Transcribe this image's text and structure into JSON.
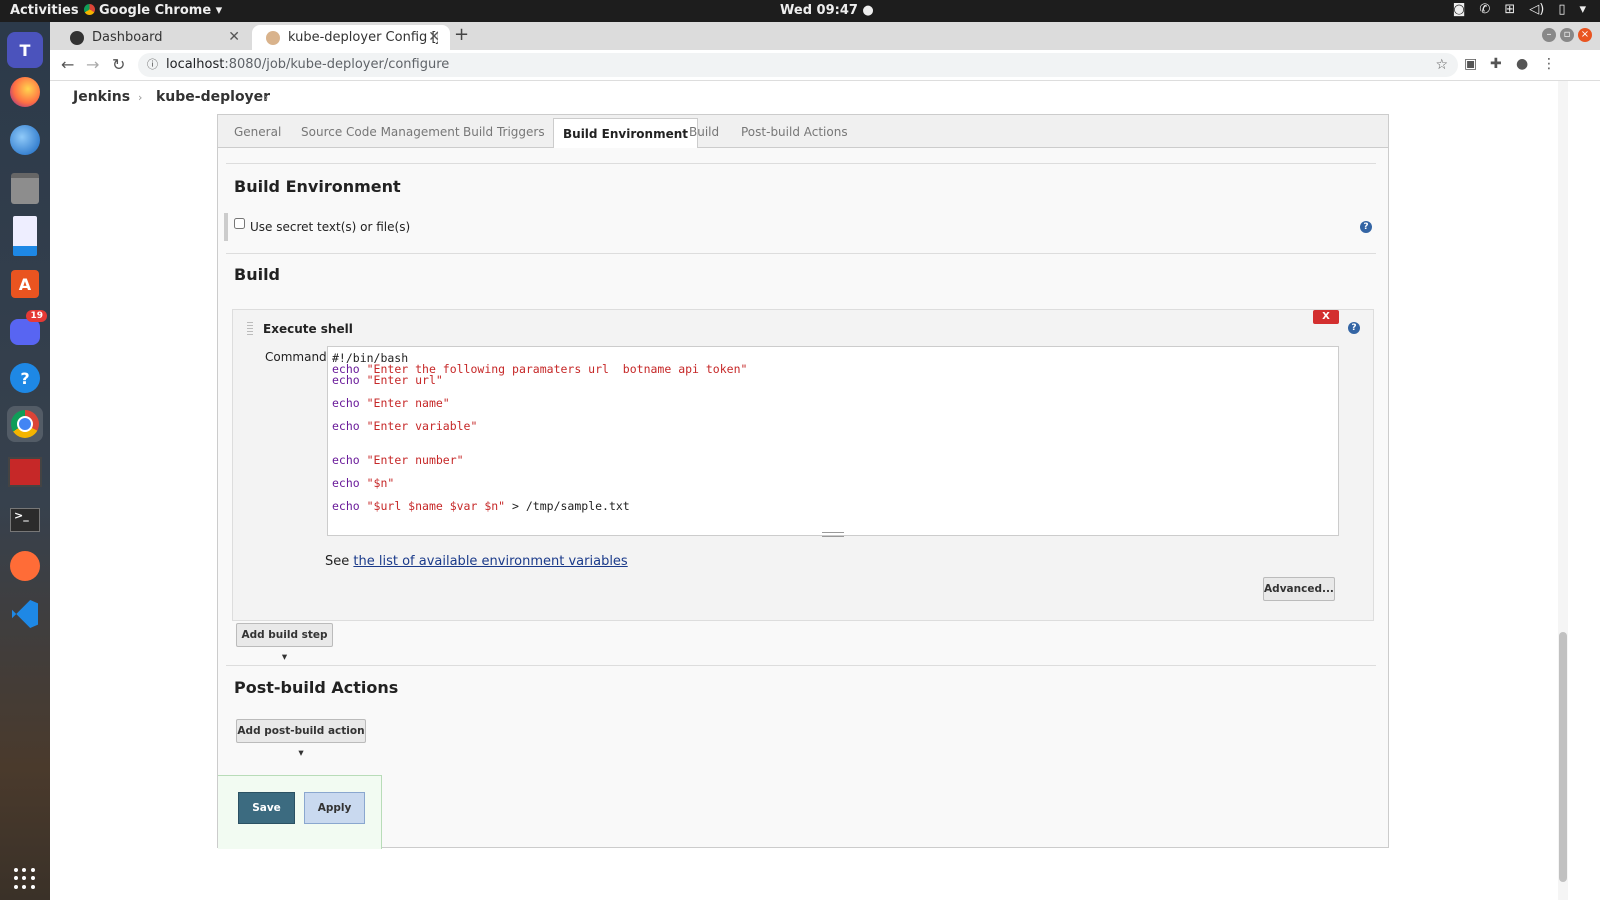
{
  "system": {
    "activities": "Activities",
    "app_name": "Google Chrome",
    "clock": "Wed 09:47"
  },
  "dock": {
    "badge_count": "19",
    "apps": [
      "teams-icon",
      "firefox-icon",
      "thunderbird-icon",
      "files-icon",
      "writer-icon",
      "software-center-icon",
      "discord-icon",
      "help-icon",
      "chrome-icon",
      "app-icon",
      "terminal-icon",
      "postman-icon",
      "vscode-icon"
    ]
  },
  "browser": {
    "tabs": [
      {
        "label": "Dashboard"
      },
      {
        "label": "kube-deployer Config [Je"
      }
    ],
    "url_host": "localhost",
    "url_path": ":8080/job/kube-deployer/configure"
  },
  "jenkins": {
    "breadcrumb": [
      "Jenkins",
      "kube-deployer"
    ],
    "config_tabs": [
      "General",
      "Source Code Management",
      "Build Triggers",
      "Build Environment",
      "Build",
      "Post-build Actions"
    ],
    "active_tab": "Build Environment",
    "build_env": {
      "title": "Build Environment",
      "secret_label": "Use secret text(s) or file(s)",
      "secret_checked": false
    },
    "build": {
      "title": "Build",
      "step_title": "Execute shell",
      "delete_label": "X",
      "command_label": "Command",
      "see_text": "See ",
      "env_link": "the list of available environment variables",
      "advanced_label": "Advanced...",
      "add_step_label": "Add build step"
    },
    "command_lines": [
      {
        "kw": "",
        "str": "",
        "plain": "#!/bin/bash"
      },
      {
        "kw": "echo",
        "str": " \"Enter the following paramaters url  botname api token\"",
        "plain": ""
      },
      {
        "kw": "echo",
        "str": " \"Enter url\"",
        "plain": ""
      },
      {
        "kw": "echo",
        "str": " \"Enter name\"",
        "plain": ""
      },
      {
        "kw": "echo",
        "str": " \"Enter variable\"",
        "plain": ""
      },
      {
        "kw": "echo",
        "str": " \"Enter number\"",
        "plain": ""
      },
      {
        "kw": "echo",
        "str": " \"$n\"",
        "plain": ""
      },
      {
        "kw": "echo",
        "str": " \"$url $name $var $n\"",
        "plain": " > /tmp/sample.txt"
      }
    ],
    "post_build": {
      "title": "Post-build Actions",
      "add_action_label": "Add post-build action"
    },
    "save_label": "Save",
    "apply_label": "Apply"
  }
}
